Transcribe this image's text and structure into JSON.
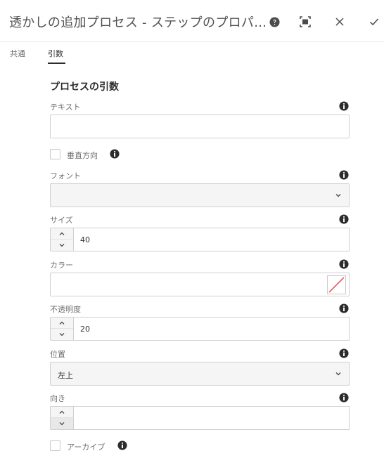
{
  "header": {
    "title": "透かしの追加プロセス - ステップのプロパ...",
    "icons": [
      "help-icon",
      "fullscreen-icon",
      "close-icon",
      "done-icon"
    ]
  },
  "tabs": [
    {
      "label": "共通",
      "active": false
    },
    {
      "label": "引数",
      "active": true
    }
  ],
  "section": {
    "title": "プロセスの引数"
  },
  "fields": {
    "text": {
      "label": "テキスト",
      "value": ""
    },
    "vertical": {
      "label": "垂直方向",
      "checked": false
    },
    "font": {
      "label": "フォント",
      "selected": ""
    },
    "size": {
      "label": "サイズ",
      "value": "40"
    },
    "color": {
      "label": "カラー",
      "value": "",
      "swatch": "none"
    },
    "opacity": {
      "label": "不透明度",
      "value": "20"
    },
    "position": {
      "label": "位置",
      "selected": "左上"
    },
    "orientation": {
      "label": "向き",
      "value": ""
    },
    "archive": {
      "label": "アーカイブ",
      "checked": false
    }
  },
  "colors": {
    "accent": "#2c2c2c",
    "swatch_slash": "#e34850"
  }
}
